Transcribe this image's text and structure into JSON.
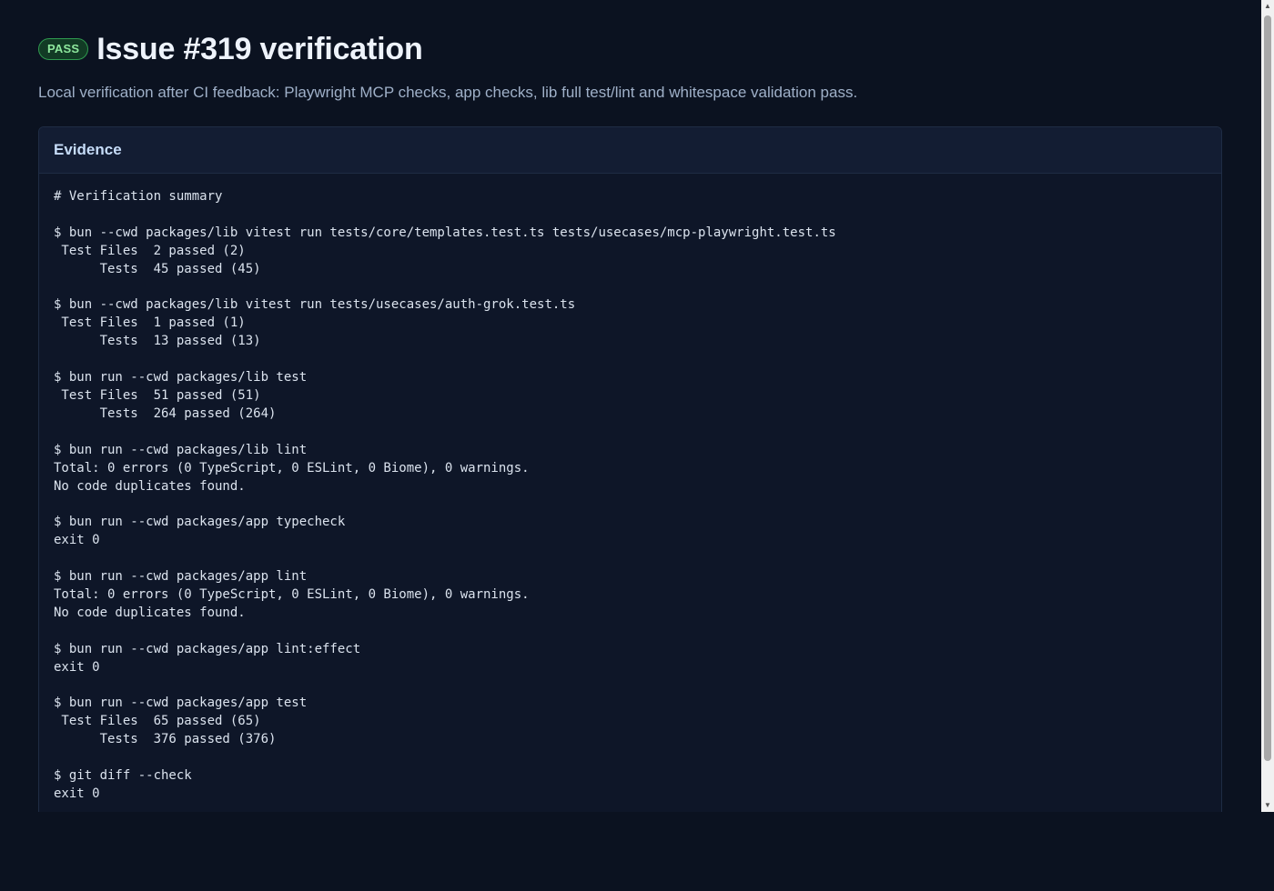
{
  "header": {
    "badge": "PASS",
    "title": "Issue #319 verification",
    "subtitle": "Local verification after CI feedback: Playwright MCP checks, app checks, lib full test/lint and whitespace validation pass."
  },
  "evidence": {
    "title": "Evidence",
    "lines": [
      "# Verification summary",
      "",
      "$ bun --cwd packages/lib vitest run tests/core/templates.test.ts tests/usecases/mcp-playwright.test.ts",
      " Test Files  2 passed (2)",
      "      Tests  45 passed (45)",
      "",
      "$ bun --cwd packages/lib vitest run tests/usecases/auth-grok.test.ts",
      " Test Files  1 passed (1)",
      "      Tests  13 passed (13)",
      "",
      "$ bun run --cwd packages/lib test",
      " Test Files  51 passed (51)",
      "      Tests  264 passed (264)",
      "",
      "$ bun run --cwd packages/lib lint",
      "Total: 0 errors (0 TypeScript, 0 ESLint, 0 Biome), 0 warnings.",
      "No code duplicates found.",
      "",
      "$ bun run --cwd packages/app typecheck",
      "exit 0",
      "",
      "$ bun run --cwd packages/app lint",
      "Total: 0 errors (0 TypeScript, 0 ESLint, 0 Biome), 0 warnings.",
      "No code duplicates found.",
      "",
      "$ bun run --cwd packages/app lint:effect",
      "exit 0",
      "",
      "$ bun run --cwd packages/app test",
      " Test Files  65 passed (65)",
      "      Tests  376 passed (376)",
      "",
      "$ git diff --check",
      "exit 0"
    ]
  },
  "colors": {
    "background": "#0b1220",
    "pass_badge": "#8ee89d",
    "card": "#0e1628"
  },
  "icons": {
    "scroll_up": "triangle-up",
    "scroll_down": "triangle-down"
  }
}
